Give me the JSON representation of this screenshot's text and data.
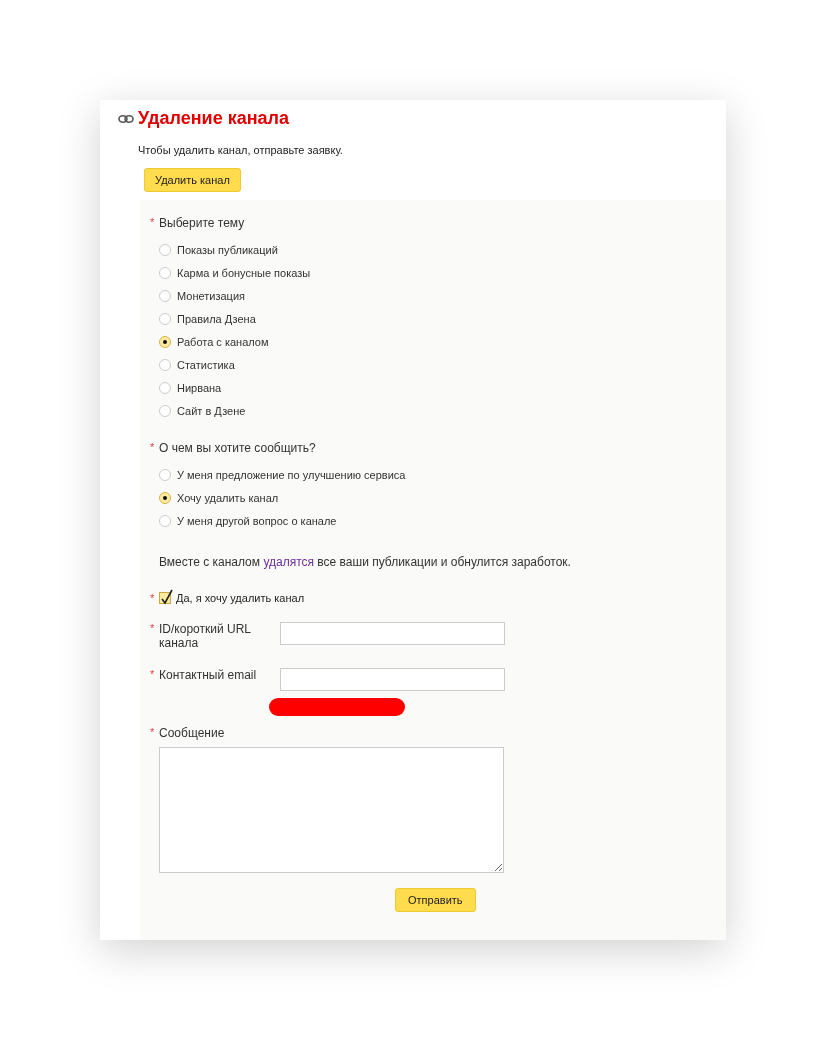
{
  "title": "Удаление канала",
  "intro": "Чтобы удалить канал, отправьте заявку.",
  "delete_button": "Удалить канал",
  "topic_question": {
    "label": "Выберите тему",
    "required_mark": "*",
    "options": [
      {
        "label": "Показы публикаций",
        "selected": false
      },
      {
        "label": "Карма и бонусные показы",
        "selected": false
      },
      {
        "label": "Монетизация",
        "selected": false
      },
      {
        "label": "Правила Дзена",
        "selected": false
      },
      {
        "label": "Работа с каналом",
        "selected": true
      },
      {
        "label": "Статистика",
        "selected": false
      },
      {
        "label": "Нирвана",
        "selected": false
      },
      {
        "label": "Сайт в Дзене",
        "selected": false
      }
    ]
  },
  "report_question": {
    "label": "О чем вы хотите сообщить?",
    "required_mark": "*",
    "options": [
      {
        "label": "У меня предложение по улучшению сервиса",
        "selected": false
      },
      {
        "label": "Хочу удалить канал",
        "selected": true
      },
      {
        "label": "У меня другой вопрос о канале",
        "selected": false
      }
    ]
  },
  "warning": {
    "before": "Вместе с каналом",
    "link": "удалятся",
    "after": "все ваши публикации и обнулится заработок."
  },
  "confirm": {
    "label": "Да, я хочу удалить канал",
    "required_mark": "*",
    "checked": true
  },
  "fields": [
    {
      "kind": "input",
      "label": "ID/короткий URL канала",
      "required_mark": "*"
    },
    {
      "kind": "input",
      "label": "Контактный email",
      "required_mark": "*",
      "redacted_note": true
    },
    {
      "kind": "textarea",
      "label": "Сообщение",
      "required_mark": "*"
    }
  ],
  "submit_button": "Отправить"
}
